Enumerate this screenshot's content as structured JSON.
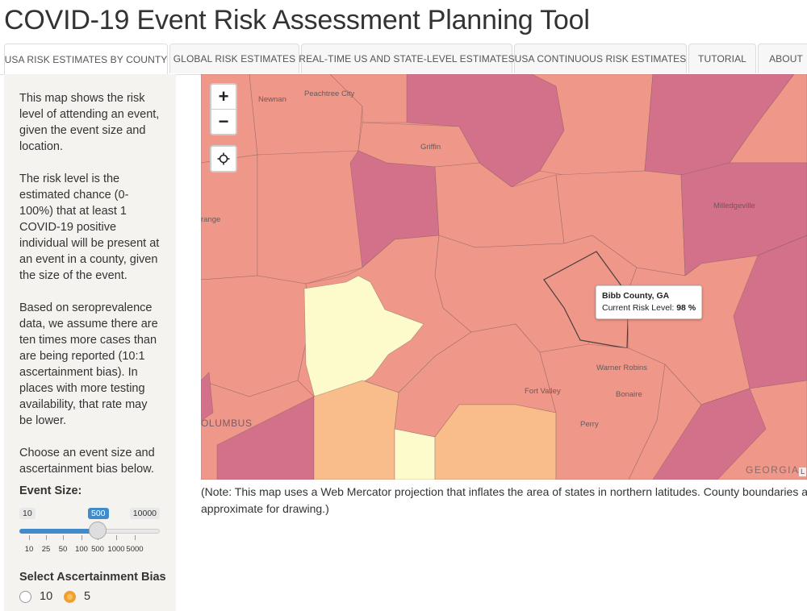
{
  "title": "COVID-19 Event Risk Assessment Planning Tool",
  "tabs": [
    {
      "label": "USA RISK ESTIMATES BY COUNTY",
      "active": true
    },
    {
      "label": "GLOBAL RISK ESTIMATES",
      "active": false
    },
    {
      "label": "REAL-TIME US AND STATE-LEVEL ESTIMATES",
      "active": false
    },
    {
      "label": "USA CONTINUOUS RISK ESTIMATES",
      "active": false
    },
    {
      "label": "TUTORIAL",
      "active": false
    },
    {
      "label": "ABOUT",
      "active": false
    }
  ],
  "sidebar": {
    "paragraphs": [
      "This map shows the risk level of attending an event, given the event size and location.",
      "The risk level is the estimated chance (0-100%) that at least 1 COVID-19 positive individual will be present at an event in a county, given the size of the event.",
      "Based on seroprevalence data, we assume there are ten times more cases than are being reported (10:1 ascertainment bias). In places with more testing availability, that rate may be lower.",
      "Choose an event size and ascertainment bias below."
    ],
    "event_size_label": "Event Size:",
    "slider": {
      "min": "10",
      "max": "10000",
      "value": "500",
      "value_fraction": 0.56,
      "ticks": [
        "10",
        "25",
        "50",
        "100",
        "500",
        "1000",
        "5000"
      ]
    },
    "bias_label": "Select Ascertainment Bias",
    "bias_options": [
      {
        "label": "10",
        "selected": false
      },
      {
        "label": "5",
        "selected": true
      }
    ]
  },
  "map": {
    "zoom_in": "+",
    "zoom_out": "−",
    "locate_icon": "crosshair-icon",
    "labels": {
      "newnan": "Newnan",
      "peachtree_city": "Peachtree City",
      "griffin": "Griffin",
      "grange": "range",
      "milledgeville": "Milledgeville",
      "warner_robins": "Warner Robins",
      "fort_valley": "Fort Valley",
      "bonaire": "Bonaire",
      "perry": "Perry",
      "columbus": "OLUMBUS",
      "georgia": "GEORGIA",
      "attribution": "L"
    },
    "tooltip": {
      "county": "Bibb County, GA",
      "risk_label": "Current Risk Level:",
      "risk_value": "98",
      "risk_unit": "%"
    },
    "colors": {
      "dark": "#d4718a",
      "mid": "#ef9788",
      "light_orange": "#f9bd8c",
      "pale": "#fdfbcb"
    }
  },
  "note": "(Note: This map uses a Web Mercator projection that inflates the area of states in northern latitudes. County boundaries are approximate for drawing.)"
}
